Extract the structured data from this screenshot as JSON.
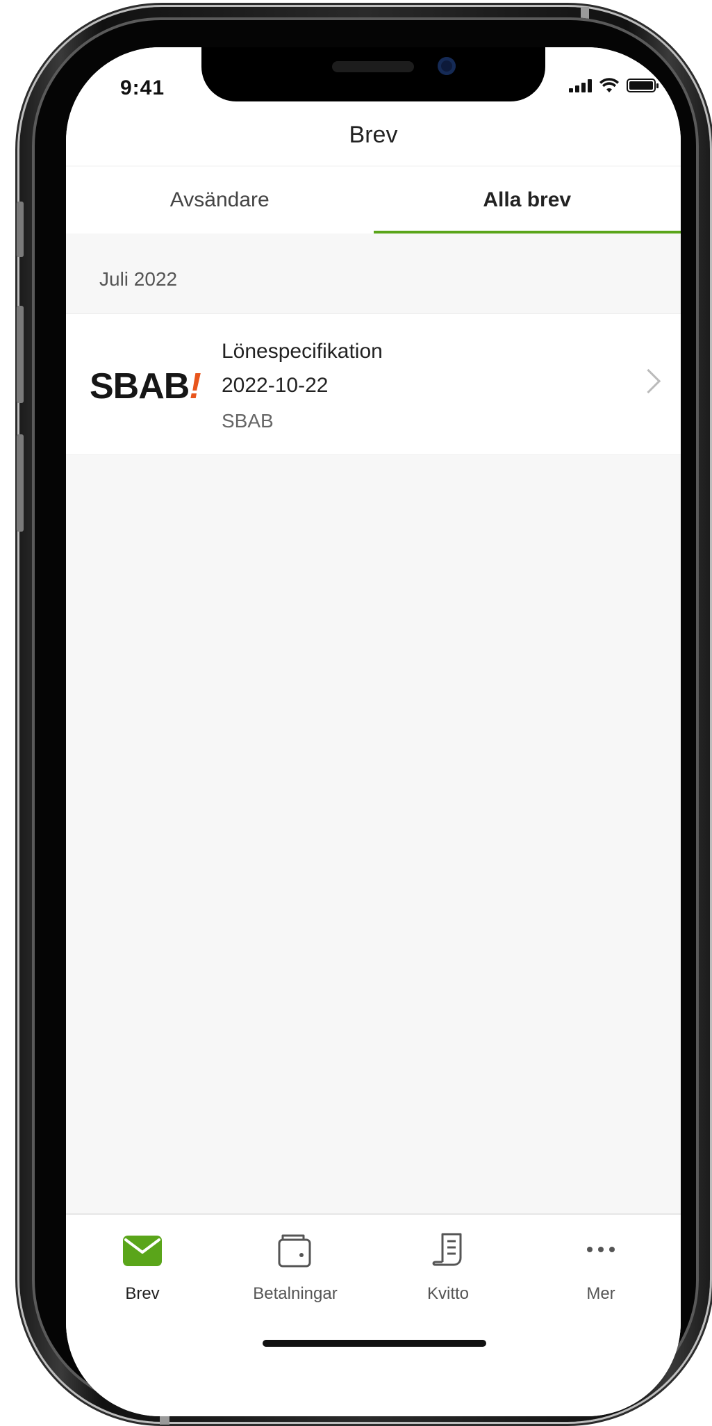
{
  "status_bar": {
    "time": "9:41"
  },
  "header": {
    "title": "Brev"
  },
  "tabs": [
    {
      "label": "Avsändare",
      "active": false
    },
    {
      "label": "Alla brev",
      "active": true
    }
  ],
  "section": {
    "title": "Juli 2022"
  },
  "letters": [
    {
      "logo_text": "SBAB",
      "logo_mark": "!",
      "title": "Lönespecifikation",
      "date": "2022-10-22",
      "sender": "SBAB"
    }
  ],
  "tabbar": {
    "items": [
      {
        "label": "Brev",
        "icon": "envelope-icon",
        "active": true
      },
      {
        "label": "Betalningar",
        "icon": "wallet-icon",
        "active": false
      },
      {
        "label": "Kvitto",
        "icon": "receipt-icon",
        "active": false
      },
      {
        "label": "Mer",
        "icon": "more-icon",
        "active": false
      }
    ]
  },
  "colors": {
    "accent": "#5aa51a",
    "logo_accent": "#e8551c",
    "background": "#f7f7f7"
  }
}
